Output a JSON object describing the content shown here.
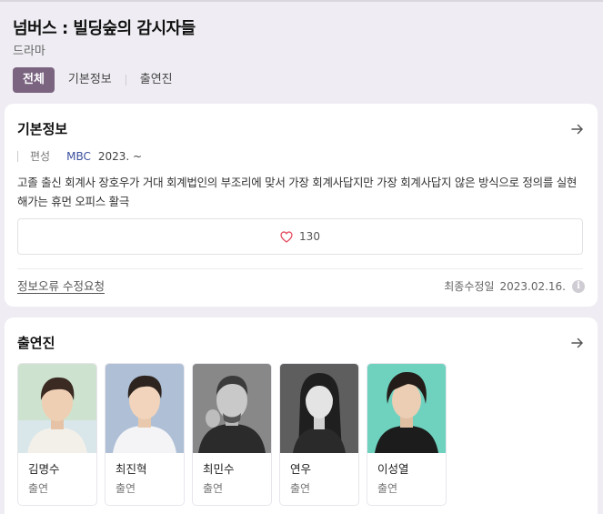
{
  "header": {
    "title": "넘버스 : 빌딩숲의 감시자들",
    "category": "드라마"
  },
  "tabs": [
    {
      "label": "전체",
      "active": true
    },
    {
      "label": "기본정보",
      "active": false
    },
    {
      "label": "출연진",
      "active": false
    }
  ],
  "basic_info": {
    "section_title": "기본정보",
    "meta_label": "편성",
    "network": "MBC",
    "year": "2023. ~",
    "synopsis": "고졸 출신 회계사 장호우가 거대 회계법인의 부조리에 맞서 가장 회계사답지만 가장 회계사답지 않은 방식으로 정의를 실현해가는 휴먼 오피스 활극",
    "likes": "130",
    "report_link": "정보오류 수정요청",
    "updated_label": "최종수정일",
    "updated_date": "2023.02.16."
  },
  "cast": {
    "section_title": "출연진",
    "members": [
      {
        "name": "김명수",
        "role": "출연",
        "photo_bg": "#cde3cf"
      },
      {
        "name": "최진혁",
        "role": "출연",
        "photo_bg": "#aebfd6"
      },
      {
        "name": "최민수",
        "role": "출연",
        "photo_bg": "#7c7c7c"
      },
      {
        "name": "연우",
        "role": "출연",
        "photo_bg": "#5e5e5e"
      },
      {
        "name": "이성열",
        "role": "출연",
        "photo_bg": "#6fd2bf"
      }
    ]
  },
  "icons": {
    "arrow": "arrow-right-icon",
    "heart": "heart-outline-icon",
    "info": "info-icon"
  },
  "colors": {
    "accent": "#7b6480",
    "link_blue": "#3a4f9c",
    "heart_red": "#e2475a"
  }
}
